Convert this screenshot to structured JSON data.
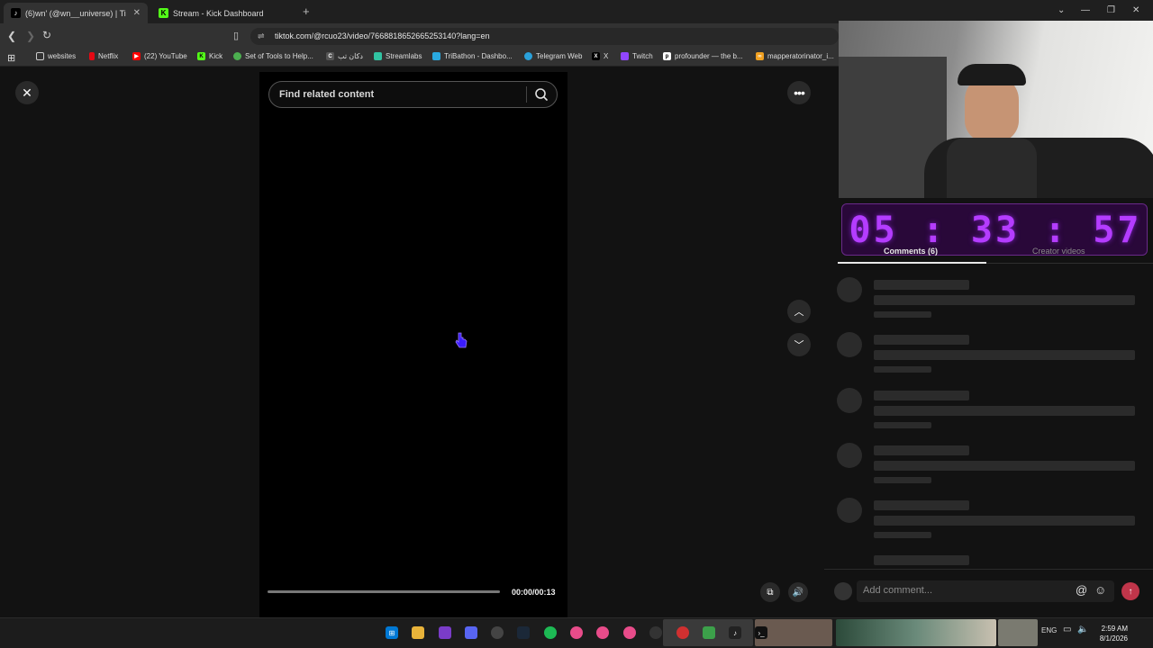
{
  "browser": {
    "tabs": [
      {
        "title": "(6)wn' (@wn__universe) | TikT",
        "active": true
      },
      {
        "title": "Stream - Kick Dashboard",
        "active": false
      }
    ],
    "url": "tiktok.com/@rcuo23/video/7668818652665253140?lang=en",
    "bookmarks": [
      "websites",
      "Netflix",
      "(22) YouTube",
      "Kick",
      "Set of Tools to Help...",
      "دكان تب",
      "Streamlabs",
      "TriBathon - Dashbo...",
      "Telegram Web",
      "X",
      "Twitch",
      "profounder — the b...",
      "mapperatorinator_i..."
    ]
  },
  "page": {
    "search_placeholder": "Find related content",
    "timecode": "00:00/00:13",
    "progress": 0
  },
  "overlay": {
    "timer": "05 : 33 : 57"
  },
  "panel": {
    "tab_comments": "Comments (6)",
    "tab_creator": "Creator videos",
    "comment_placeholder": "Add comment..."
  },
  "taskbar": {
    "lang": "ENG",
    "time": "2:59 AM",
    "date": "8/1/2026"
  },
  "colors": {
    "accent_post": "#c0354a",
    "timer": "#b43cff"
  }
}
